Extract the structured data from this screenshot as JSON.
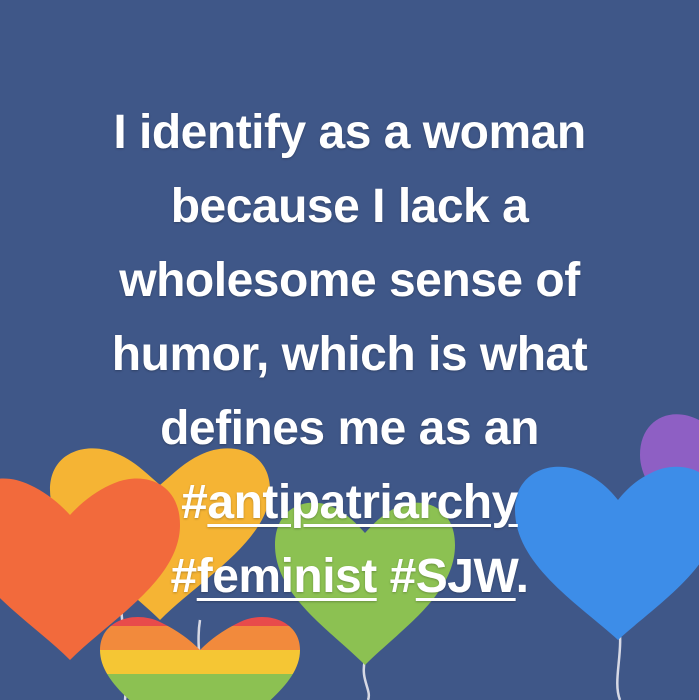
{
  "post": {
    "lines": [
      "I identify as a woman",
      "because I lack a",
      "wholesome sense of",
      "humor, which is what",
      "defines me as an"
    ],
    "hashtags": [
      {
        "hash": "#",
        "word": "antipatriarchy"
      },
      {
        "hash": "#",
        "word": "feminist"
      },
      {
        "hash": "#",
        "word": "SJW"
      }
    ],
    "end_punct": "."
  },
  "colors": {
    "background": "#3f5788",
    "orange": "#f26a3c",
    "yellow": "#f5b434",
    "green": "#8cc152",
    "blue": "#3d8de8",
    "purple": "#8e5fc4"
  }
}
